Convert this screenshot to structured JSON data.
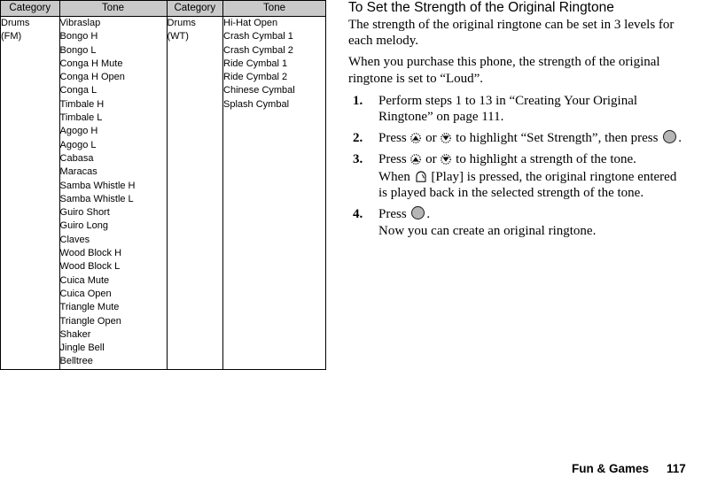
{
  "table": {
    "headers": [
      "Category",
      "Tone",
      "Category",
      "Tone"
    ],
    "groups": [
      {
        "category": [
          "Drums",
          "(FM)"
        ],
        "tones": [
          "Vibraslap",
          "Bongo H",
          "Bongo L",
          "Conga H Mute",
          "Conga H Open",
          "Conga L",
          "Timbale H",
          "Timbale L",
          "Agogo H",
          "Agogo L",
          "Cabasa",
          "Maracas",
          "Samba Whistle H",
          "Samba Whistle L",
          "Guiro Short",
          "Guiro Long",
          "Claves",
          "Wood Block H",
          "Wood Block L",
          "Cuica Mute",
          "Cuica Open",
          "Triangle Mute",
          "Triangle Open",
          "Shaker",
          "Jingle Bell",
          "Belltree"
        ]
      },
      {
        "category": [
          "Drums",
          "(WT)"
        ],
        "tones": [
          "Hi-Hat Open",
          "Crash Cymbal 1",
          "Crash Cymbal 2",
          "Ride Cymbal 1",
          "Ride Cymbal 2",
          "Chinese Cymbal",
          "Splash Cymbal"
        ]
      }
    ]
  },
  "content": {
    "heading": "To Set the Strength of the Original Ringtone",
    "intro_paragraph_1": "The strength of the original ringtone can be set in 3 levels for each melody.",
    "intro_paragraph_2": "When you purchase this phone, the strength of the original ringtone is set to “Loud”.",
    "steps": [
      {
        "number": "1.",
        "lines": [
          {
            "text_before": "Perform steps 1 to 13 in “Creating Your Original Ringtone” on page 111.",
            "icons": []
          }
        ]
      },
      {
        "number": "2.",
        "lines": [
          {
            "text_before": "Press ",
            "icon_1": "nav-up-key-icon",
            "text_mid_1": " or ",
            "icon_2": "nav-down-key-icon",
            "text_mid_2": " to highlight “Set Strength”, then press ",
            "icon_3": "center-key-icon",
            "text_after": "."
          }
        ]
      },
      {
        "number": "3.",
        "lines": [
          {
            "text_before": "Press ",
            "icon_1": "nav-up-key-icon",
            "text_mid_1": " or ",
            "icon_2": "nav-down-key-icon",
            "text_mid_2": " to highlight a strength of the tone.",
            "text_after": ""
          },
          {
            "text_before": "When ",
            "icon_1": "soft-key-icon",
            "text_mid_1": " [Play] is pressed, the original ringtone entered is played back in the selected strength of the tone.",
            "text_after": ""
          }
        ]
      },
      {
        "number": "4.",
        "lines": [
          {
            "text_before": "Press ",
            "icon_1": "center-key-icon",
            "text_after": "."
          },
          {
            "text_before": "Now you can create an original ringtone.",
            "text_after": ""
          }
        ]
      }
    ]
  },
  "footer": {
    "chapter": "Fun & Games",
    "page_number": "117"
  },
  "colors": {
    "header_fill": "#c9c9c9",
    "key_fill": "#b5b5b5",
    "border": "#000000",
    "text": "#000000"
  }
}
